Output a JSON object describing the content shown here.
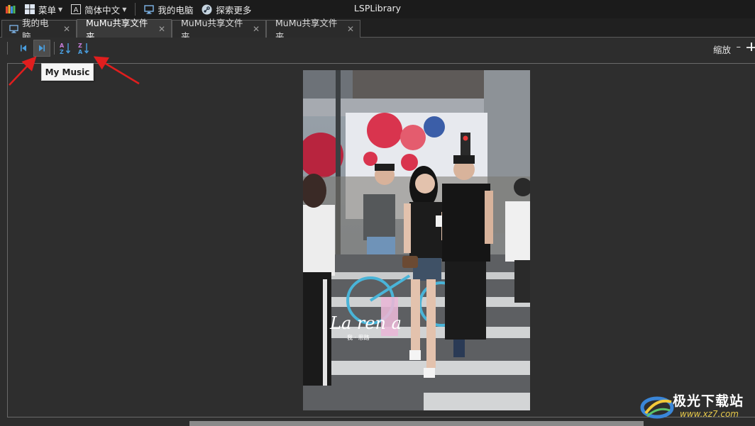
{
  "menubar": {
    "menu_label": "菜单",
    "language_label": "简体中文",
    "computer_label": "我的电脑",
    "explore_label": "探索更多",
    "title": "LSPLibrary"
  },
  "tabs": [
    {
      "label": "我的电脑",
      "active": false
    },
    {
      "label": "MuMu共享文件夹",
      "active": true
    },
    {
      "label": "MuMu共享文件夹",
      "active": false
    },
    {
      "label": "MuMu共享文件夹",
      "active": false
    }
  ],
  "tab_close_glyph": "✕",
  "toolbar": {
    "zoom_label": "缩放",
    "zoom_minus": "–"
  },
  "tooltip": {
    "text": "My Music"
  },
  "photo": {
    "signature": "La ren a",
    "signature_sub": "我 · 思路"
  },
  "watermark": {
    "main": "极光下载站",
    "url": "www.xz7.com"
  },
  "colors": {
    "menubar_bg": "#1b1b1b",
    "tab_active_bg": "#3a3a3a",
    "panel_bg": "#2d2d2d",
    "annotation_arrow": "#e01e1e",
    "sort_icon_accent": "#c77dd8",
    "nav_icon_accent": "#4a9fe0"
  }
}
